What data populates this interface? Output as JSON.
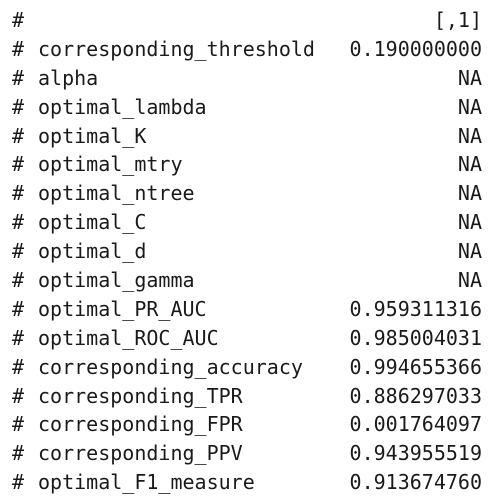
{
  "console": {
    "header": {
      "prefix": "#",
      "column_label": "[,1]"
    },
    "rows": [
      {
        "prefix": "#",
        "name": "corresponding_threshold",
        "value": "0.190000000"
      },
      {
        "prefix": "#",
        "name": "alpha",
        "value": "NA"
      },
      {
        "prefix": "#",
        "name": "optimal_lambda",
        "value": "NA"
      },
      {
        "prefix": "#",
        "name": "optimal_K",
        "value": "NA"
      },
      {
        "prefix": "#",
        "name": "optimal_mtry",
        "value": "NA"
      },
      {
        "prefix": "#",
        "name": "optimal_ntree",
        "value": "NA"
      },
      {
        "prefix": "#",
        "name": "optimal_C",
        "value": "NA"
      },
      {
        "prefix": "#",
        "name": "optimal_d",
        "value": "NA"
      },
      {
        "prefix": "#",
        "name": "optimal_gamma",
        "value": "NA"
      },
      {
        "prefix": "#",
        "name": "optimal_PR_AUC",
        "value": "0.959311316"
      },
      {
        "prefix": "#",
        "name": "optimal_ROC_AUC",
        "value": "0.985004031"
      },
      {
        "prefix": "#",
        "name": "corresponding_accuracy",
        "value": "0.994655366"
      },
      {
        "prefix": "#",
        "name": "corresponding_TPR",
        "value": "0.886297033"
      },
      {
        "prefix": "#",
        "name": "corresponding_FPR",
        "value": "0.001764097"
      },
      {
        "prefix": "#",
        "name": "corresponding_PPV",
        "value": "0.943955519"
      },
      {
        "prefix": "#",
        "name": "optimal_F1_measure",
        "value": "0.913674760"
      }
    ]
  }
}
